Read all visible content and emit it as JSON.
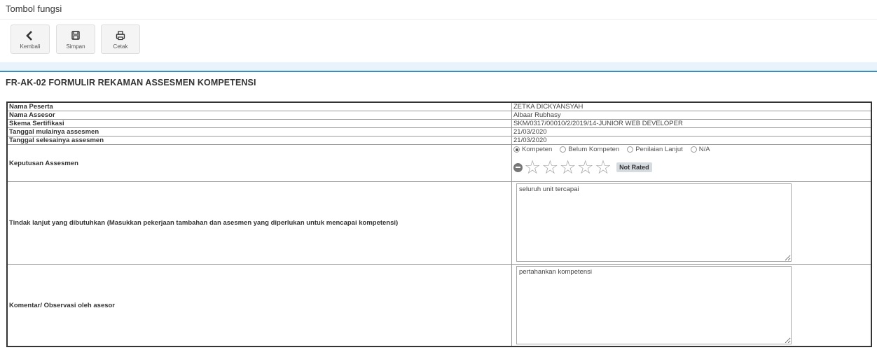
{
  "header": {
    "title": "Tombol fungsi"
  },
  "toolbar": {
    "back_label": "Kembali",
    "save_label": "Simpan",
    "print_label": "Cetak"
  },
  "form": {
    "title": "FR-AK-02 FORMULIR REKAMAN ASSESMEN KOMPETENSI",
    "rows": {
      "peserta": {
        "label": "Nama Peserta",
        "value": "ZETKA DICKYANSYAH"
      },
      "assesor": {
        "label": "Nama Assesor",
        "value": "Albaar Rubhasy"
      },
      "skema": {
        "label": "Skema Sertifikasi",
        "value": "SKM/0317/00010/2/2019/14-JUNIOR WEB DEVELOPER"
      },
      "mulai": {
        "label": "Tanggal mulainya assesmen",
        "value": "21/03/2020"
      },
      "selesai": {
        "label": "Tanggal selesainya assesmen",
        "value": "21/03/2020"
      },
      "keputusan": {
        "label": "Keputusan Assesmen",
        "options": [
          "Kompeten",
          "Belum Kompeten",
          "Penilaian Lanjut",
          "N/A"
        ],
        "selected": "Kompeten",
        "rating_value": 0,
        "rating_max": 5,
        "rating_badge": "Not Rated"
      },
      "tindak": {
        "label": "Tindak lanjut yang dibutuhkan (Masukkan pekerjaan tambahan dan asesmen yang diperlukan untuk mencapai kompetensi)",
        "value": "seluruh unit tercapai"
      },
      "komentar": {
        "label": "Komentar/ Observasi oleh asesor",
        "value": "pertahankan kompetensi"
      }
    }
  }
}
